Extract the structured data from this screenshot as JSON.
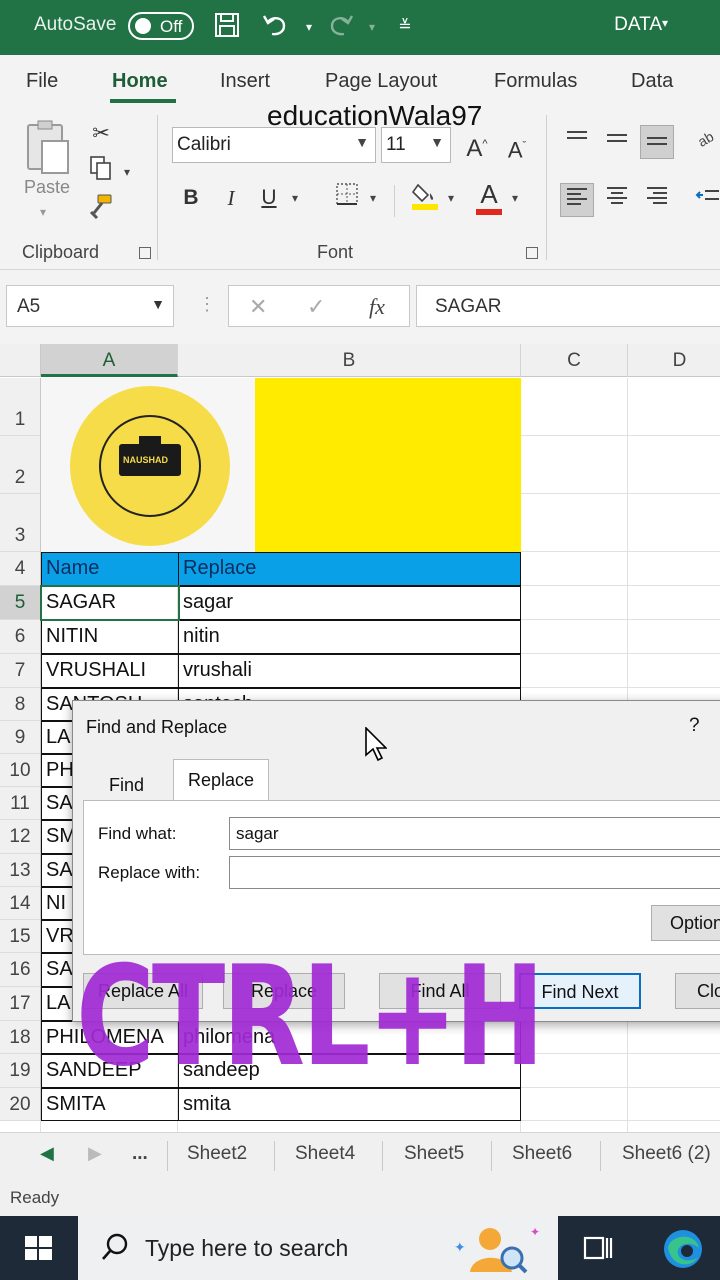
{
  "titlebar": {
    "autosave_label": "AutoSave",
    "autosave_state": "Off",
    "doc_name": "DATA"
  },
  "tabs": [
    {
      "label": "File"
    },
    {
      "label": "Home"
    },
    {
      "label": "Insert"
    },
    {
      "label": "Page Layout"
    },
    {
      "label": "Formulas"
    },
    {
      "label": "Data"
    }
  ],
  "active_tab": "Home",
  "ribbon": {
    "paste_label": "Paste",
    "clipboard_label": "Clipboard",
    "font_label": "Font",
    "font_name": "Calibri",
    "font_size": "11",
    "bold": "B",
    "italic": "I",
    "underline": "U",
    "grow_font": "A",
    "shrink_font": "A",
    "font_color_glyph": "A",
    "colors": {
      "font_color": "#e0281f",
      "highlight": "#ffe600",
      "accent": "#217346"
    }
  },
  "formula_bar": {
    "cell_ref": "A5",
    "fx": "fx",
    "formula": "SAGAR"
  },
  "columns": [
    "A",
    "B",
    "C",
    "D"
  ],
  "rows": [
    "1",
    "2",
    "3",
    "4",
    "5",
    "6",
    "7",
    "8",
    "9",
    "10",
    "11",
    "12",
    "13",
    "14",
    "15",
    "16",
    "17",
    "18",
    "19",
    "20"
  ],
  "sheet": {
    "brand": "educationWala97",
    "logo_text": "NAUSHAD",
    "header": {
      "a": "Name",
      "b": "Replace"
    },
    "data": [
      {
        "a": "SAGAR",
        "b": "sagar"
      },
      {
        "a": "NITIN",
        "b": "nitin"
      },
      {
        "a": "VRUSHALI",
        "b": "vrushali"
      },
      {
        "a": "SANTOSH",
        "b": "santosh"
      },
      {
        "a": "LA",
        "b": ""
      },
      {
        "a": "PH",
        "b": ""
      },
      {
        "a": "SA",
        "b": ""
      },
      {
        "a": "SM",
        "b": ""
      },
      {
        "a": "SA",
        "b": ""
      },
      {
        "a": "NI",
        "b": ""
      },
      {
        "a": "VR",
        "b": ""
      },
      {
        "a": "SA",
        "b": ""
      },
      {
        "a": "LA",
        "b": ""
      },
      {
        "a": "PHILOMENA",
        "b": "philomena"
      },
      {
        "a": "SANDEEP",
        "b": "sandeep"
      },
      {
        "a": "SMITA",
        "b": "smita"
      }
    ]
  },
  "dialog": {
    "title": "Find and Replace",
    "help": "?",
    "tabs": [
      "Find",
      "Replace"
    ],
    "active_tab": "Replace",
    "find_label": "Find what:",
    "find_value": "sagar",
    "replace_label": "Replace with:",
    "replace_value": "",
    "options_label": "Options",
    "buttons": [
      "Replace All",
      "Replace",
      "Find All",
      "Find Next",
      "Close"
    ]
  },
  "overlay_text": "CTRL+H",
  "sheet_tabs": {
    "more": "...",
    "tabs": [
      "Sheet2",
      "Sheet4",
      "Sheet5",
      "Sheet6",
      "Sheet6 (2)"
    ]
  },
  "status": "Ready",
  "taskbar": {
    "search_placeholder": "Type here to search"
  }
}
